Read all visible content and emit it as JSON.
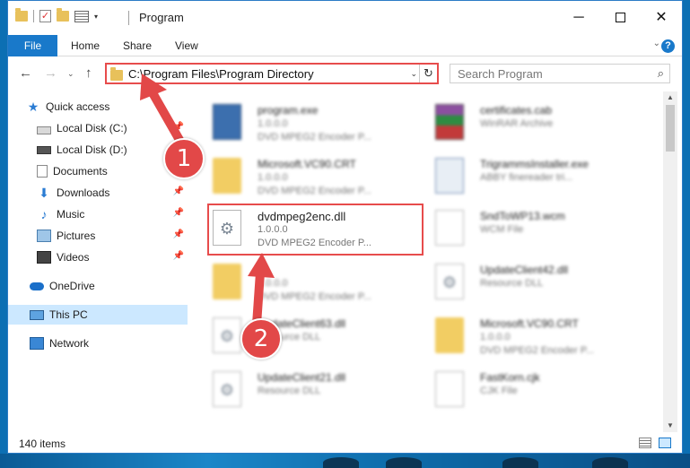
{
  "window": {
    "title": "Program",
    "minimize_label": "─",
    "close_label": "✕"
  },
  "qat": {
    "check_glyph": "✓",
    "caret_glyph": "▾"
  },
  "ribbon": {
    "tabs": [
      {
        "label": "File"
      },
      {
        "label": "Home"
      },
      {
        "label": "Share"
      },
      {
        "label": "View"
      }
    ],
    "expand_glyph": "⌄",
    "help_glyph": "?"
  },
  "nav": {
    "back_glyph": "←",
    "forward_glyph": "→",
    "recent_glyph": "⌄",
    "up_glyph": "↑",
    "address": "C:\\Program Files\\Program Directory",
    "address_dropdown_glyph": "⌄",
    "refresh_glyph": "↻",
    "search_placeholder": "Search Program",
    "search_glyph": "⌕"
  },
  "sidebar": {
    "pin_glyph": "📌",
    "items": [
      {
        "label": "Quick access",
        "icon": "star-icon",
        "glyph": "★"
      },
      {
        "label": "Local Disk (C:)",
        "icon": "drive-icon",
        "pinned": true
      },
      {
        "label": "Local Disk (D:)",
        "icon": "drive-icon",
        "pinned": true
      },
      {
        "label": "Documents",
        "icon": "documents-icon",
        "pinned": true
      },
      {
        "label": "Downloads",
        "icon": "downloads-icon",
        "glyph": "⬇",
        "pinned": true
      },
      {
        "label": "Music",
        "icon": "music-icon",
        "glyph": "♪",
        "pinned": true
      },
      {
        "label": "Pictures",
        "icon": "pictures-icon",
        "pinned": true
      },
      {
        "label": "Videos",
        "icon": "videos-icon",
        "pinned": true
      },
      {
        "label": "OneDrive",
        "icon": "onedrive-icon"
      },
      {
        "label": "This PC",
        "icon": "pc-icon",
        "selected": true
      },
      {
        "label": "Network",
        "icon": "network-icon"
      }
    ]
  },
  "files": [
    {
      "name": "program.exe",
      "line2": "1.0.0.0",
      "line3": "DVD MPEG2 Encoder P...",
      "icon": "exe-icon"
    },
    {
      "name": "certificates.cab",
      "line2": "WinRAR Archive",
      "line3": "",
      "icon": "rar-icon"
    },
    {
      "name": "Microsoft.VC90.CRT",
      "line2": "1.0.0.0",
      "line3": "DVD MPEG2 Encoder P...",
      "icon": "folder-icon"
    },
    {
      "name": "TrigrammsInstaller.exe",
      "line2": "ABBY finereader tri...",
      "line3": "",
      "icon": "installer-icon"
    },
    {
      "name": "dvdmpeg2enc.dll",
      "line2": "1.0.0.0",
      "line3": "DVD MPEG2 Encoder P...",
      "icon": "dll-gear-icon",
      "highlighted": true
    },
    {
      "name": "SndToWP13.wcm",
      "line2": "WCM File",
      "line3": "",
      "icon": "file-icon"
    },
    {
      "name": "",
      "line2": "1.0.0.0",
      "line3": "DVD MPEG2 Encoder P...",
      "icon": "folder-icon"
    },
    {
      "name": "UpdateClient42.dll",
      "line2": "Resource DLL",
      "line3": "",
      "icon": "dll-gear-icon"
    },
    {
      "name": "UpdateClient63.dll",
      "line2": "Resource DLL",
      "line3": "",
      "icon": "dll-gear-icon"
    },
    {
      "name": "Microsoft.VC90.CRT",
      "line2": "1.0.0.0",
      "line3": "DVD MPEG2 Encoder P...",
      "icon": "folder-icon"
    },
    {
      "name": "UpdateClient21.dll",
      "line2": "Resource DLL",
      "line3": "",
      "icon": "dll-gear-icon"
    },
    {
      "name": "FastKorn.cjk",
      "line2": "CJK File",
      "line3": "",
      "icon": "file-icon"
    }
  ],
  "status": {
    "item_count": "140 items"
  },
  "annotations": {
    "badge1": "1",
    "badge2": "2",
    "color": "#e24848"
  },
  "scroll": {
    "up_glyph": "▲",
    "down_glyph": "▼"
  }
}
